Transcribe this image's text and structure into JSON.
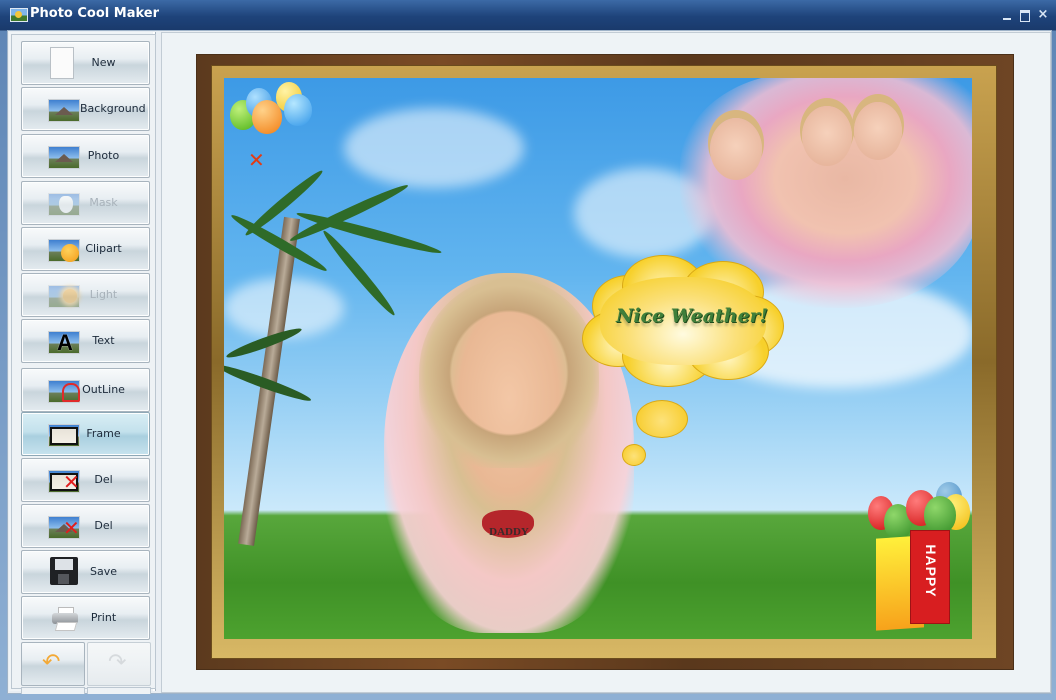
{
  "window": {
    "title": "Photo Cool Maker",
    "controls": {
      "minimize": "minimize",
      "maximize": "maximize",
      "close": "×"
    }
  },
  "sidebar": {
    "tools": [
      {
        "label": "New",
        "icon": "new-document-icon",
        "state": "enabled"
      },
      {
        "label": "Background",
        "icon": "background-photo-icon",
        "state": "enabled"
      },
      {
        "label": "Photo",
        "icon": "photo-icon",
        "state": "enabled"
      },
      {
        "label": "Mask",
        "icon": "mask-icon",
        "state": "disabled"
      },
      {
        "label": "Clipart",
        "icon": "clipart-smiley-icon",
        "state": "enabled"
      },
      {
        "label": "Light",
        "icon": "light-sun-icon",
        "state": "disabled"
      },
      {
        "label": "Text",
        "icon": "text-icon",
        "state": "enabled"
      },
      {
        "label": "OutLine",
        "icon": "outline-icon",
        "state": "enabled"
      },
      {
        "label": "Frame",
        "icon": "frame-icon",
        "state": "active"
      },
      {
        "label": "Del Frame",
        "icon": "delete-frame-icon",
        "state": "enabled"
      },
      {
        "label": "Del Layer",
        "icon": "delete-layer-icon",
        "state": "enabled"
      },
      {
        "label": "Save",
        "icon": "floppy-disk-icon",
        "state": "enabled"
      },
      {
        "label": "Print",
        "icon": "printer-icon",
        "state": "enabled"
      }
    ],
    "undo": {
      "icon": "undo-arrow-icon",
      "glyph": "↶",
      "state": "enabled"
    },
    "redo": {
      "icon": "redo-arrow-icon",
      "glyph": "↷",
      "state": "disabled"
    }
  },
  "canvas": {
    "speech_bubble_text": "Nice Weather!",
    "shirt_text": "DADDY",
    "banner_text": "HAPPY",
    "bow_glyph": "✕"
  }
}
